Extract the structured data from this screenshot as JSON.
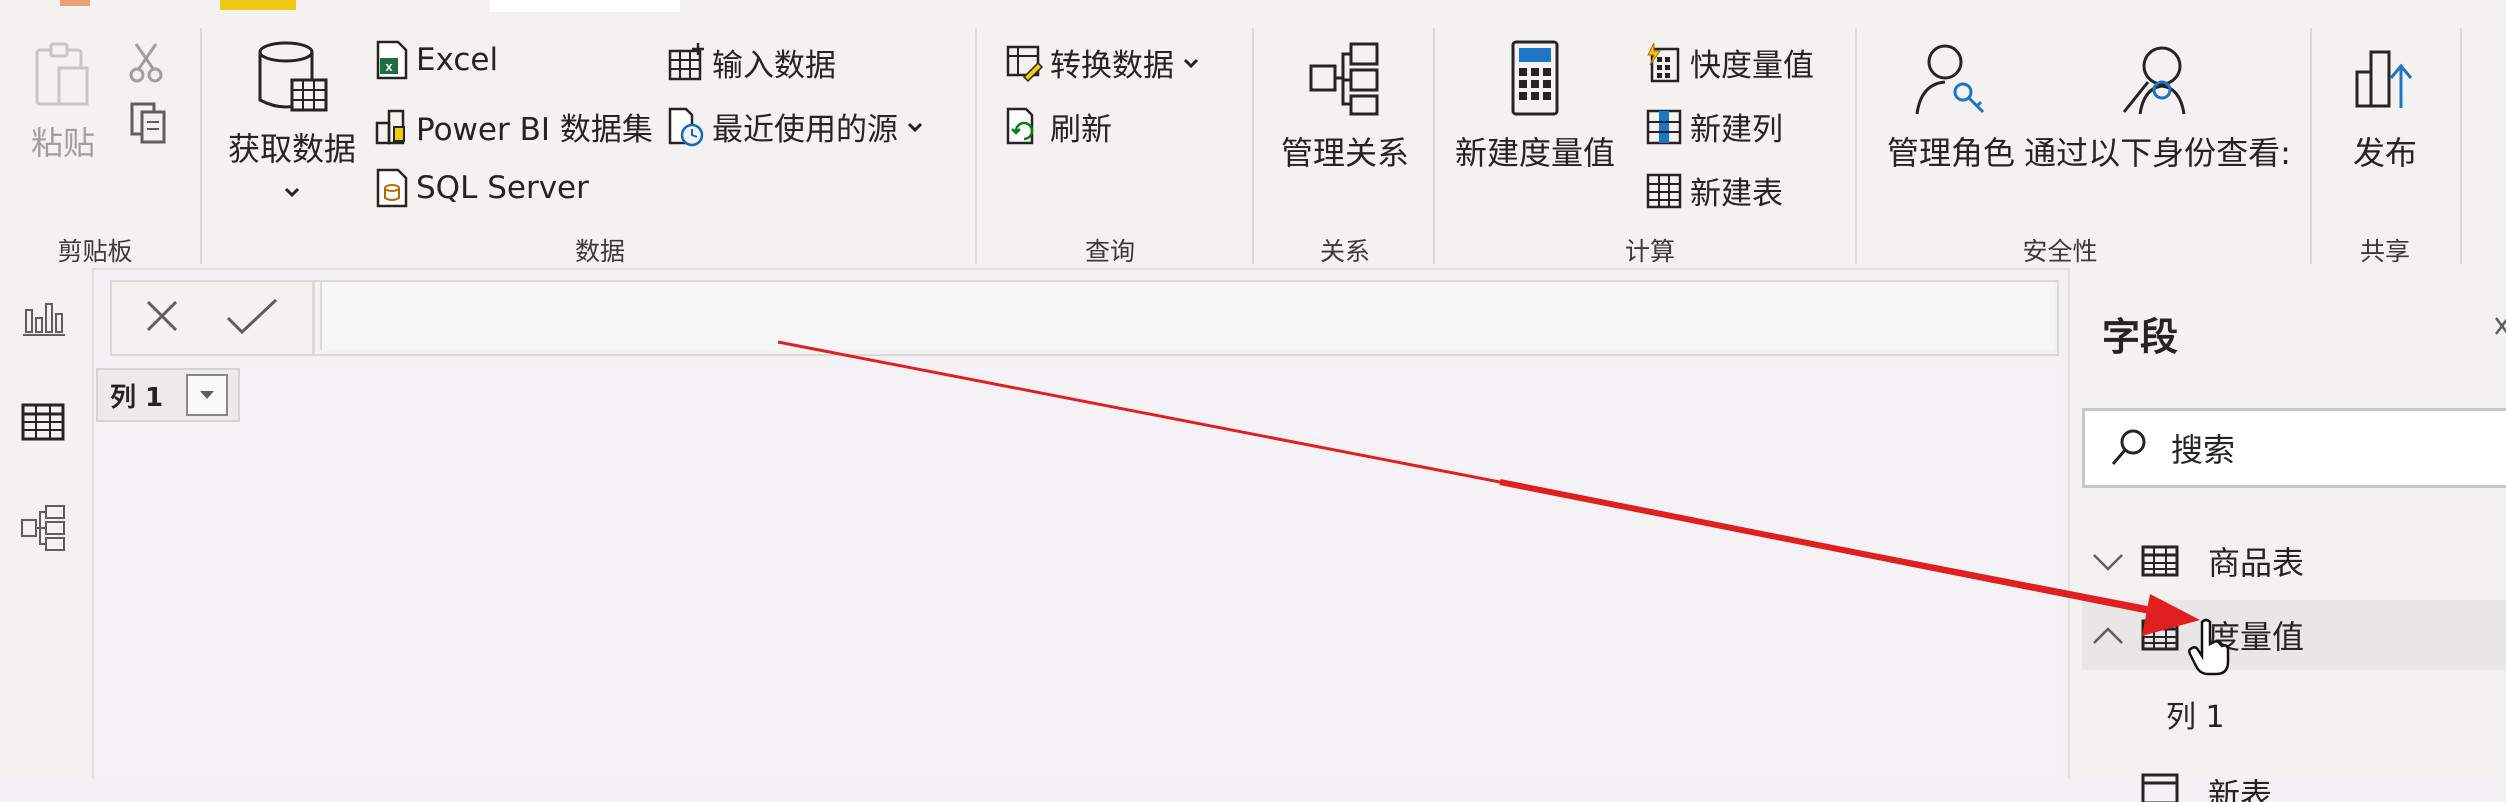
{
  "ribbon": {
    "clipboard": {
      "paste": "粘贴",
      "group": "剪贴板"
    },
    "data": {
      "get_data": "获取数据",
      "excel": "Excel",
      "powerbi_dataset": "Power BI 数据集",
      "sql_server": "SQL Server",
      "enter_data": "输入数据",
      "recent_sources": "最近使用的源",
      "group": "数据"
    },
    "query": {
      "transform": "转换数据",
      "refresh": "刷新",
      "group": "查询"
    },
    "relationships": {
      "manage": "管理关系",
      "group": "关系"
    },
    "calculations": {
      "new_measure": "新建度量值",
      "quick_measure": "快度量值",
      "new_column": "新建列",
      "new_table": "新建表",
      "group": "计算"
    },
    "security": {
      "manage_roles": "管理角色",
      "view_as": "通过以下身份查看:",
      "group": "安全性"
    },
    "share": {
      "publish": "发布",
      "group": "共享"
    }
  },
  "formula_bar": {
    "value": ""
  },
  "grid": {
    "column_header": "列 1"
  },
  "fields_pane": {
    "title": "字段",
    "search_placeholder": "搜索",
    "tables": [
      {
        "name": "商品表",
        "expanded": false
      },
      {
        "name": "度量值",
        "expanded": true,
        "children": [
          "列 1"
        ]
      },
      {
        "name": "新表",
        "expanded": false
      }
    ]
  },
  "colors": {
    "accent": "#f2c811",
    "annotation_arrow": "#e02020"
  }
}
